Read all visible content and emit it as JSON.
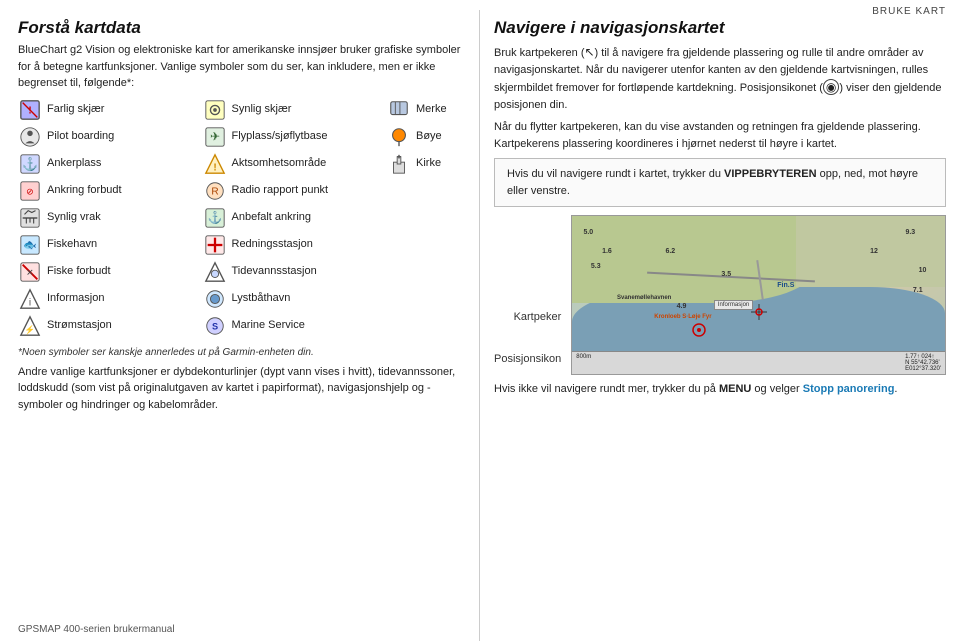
{
  "page": {
    "top_right_label": "Bruke kart",
    "footer_text": "GPSMAP 400-serien brukermanual"
  },
  "left": {
    "heading": "Forstå kartdata",
    "intro": "BlueChart g2 Vision og elektroniske kart for amerikanske innsjøer bruker grafiske symboler for å betegne kartfunksjoner. Vanlige symboler som du ser, kan inkludere, men er ikke begrenset til, følgende*:",
    "symbols_col1": [
      {
        "label": "Farlig skjær",
        "icon": "danger"
      },
      {
        "label": "Pilot boarding",
        "icon": "pilot"
      },
      {
        "label": "Ankerplass",
        "icon": "anchor"
      },
      {
        "label": "Ankring forbudt",
        "icon": "no-anchor"
      },
      {
        "label": "Synlig vrak",
        "icon": "wreck"
      },
      {
        "label": "Fiskehavn",
        "icon": "fishing"
      },
      {
        "label": "Fiske forbudt",
        "icon": "no-fish"
      },
      {
        "label": "Informasjon",
        "icon": "info"
      },
      {
        "label": "Strømstasjon",
        "icon": "power"
      }
    ],
    "symbols_col2": [
      {
        "label": "Synlig skjær",
        "icon": "rock"
      },
      {
        "label": "Flyplass/sjøflytbase",
        "icon": "airport"
      },
      {
        "label": "Aktsomhetsområde",
        "icon": "caution"
      },
      {
        "label": "Radio rapport punkt",
        "icon": "radio"
      },
      {
        "label": "Anbefalt ankring",
        "icon": "rec-anchor"
      },
      {
        "label": "Redningsstasjon",
        "icon": "rescue"
      },
      {
        "label": "Tidevannsstasjon",
        "icon": "tide"
      },
      {
        "label": "Lystbåthavn",
        "icon": "marina"
      },
      {
        "label": "Marine Service",
        "icon": "marine"
      }
    ],
    "symbols_col3": [
      {
        "label": "Merke",
        "icon": "marker"
      },
      {
        "label": "Bøye",
        "icon": "buoy"
      },
      {
        "label": "Kirke",
        "icon": "church"
      }
    ],
    "footnote": "*Noen symboler ser kanskje annerledes ut på Garmin-enheten din.",
    "body_text": "Andre vanlige kartfunksjoner er dybdekonturlinjer (dypt vann vises i hvitt), tidevannssoner, loddskudd (som vist på originalutgaven av kartet i papirformat), navigasjonshjelp og -symboler og hindringer og kabelområder."
  },
  "right": {
    "heading": "Navigere i navigasjonskartet",
    "para1": "Bruk kartpekeren (↖) til å navigere fra gjeldende plassering og rulle til andre områder av navigasjonskartet. Når du navigerer utenfor kanten av den gjeldende kartvisningen, rulles skjermbildet fremover for fortløpende kartdekning. Posisjonsikonet (◉) viser den gjeldende posisjonen din.",
    "para2": "Når du flytter kartpekeren, kan du vise avstanden og retningen fra gjeldende plassering. Kartpekerens plassering koordineres i hjørnet nederst til høyre i kartet.",
    "highlight_text": "Hvis du vil navigere rundt i kartet, trykker du VIPPEBRYTEREN opp, ned, mot høyre eller venstre.",
    "highlight_bold": "VIPPEBRYTEREN",
    "map_label_kartpeker": "Kartpeker",
    "map_label_posisjonsikon": "Posisjonsikon",
    "bottom_text": "Hvis ikke vil navigere rundt mer, trykker du på MENU og velger Stopp panorering.",
    "bottom_menu": "MENU",
    "bottom_stop": "Stopp panorering"
  }
}
